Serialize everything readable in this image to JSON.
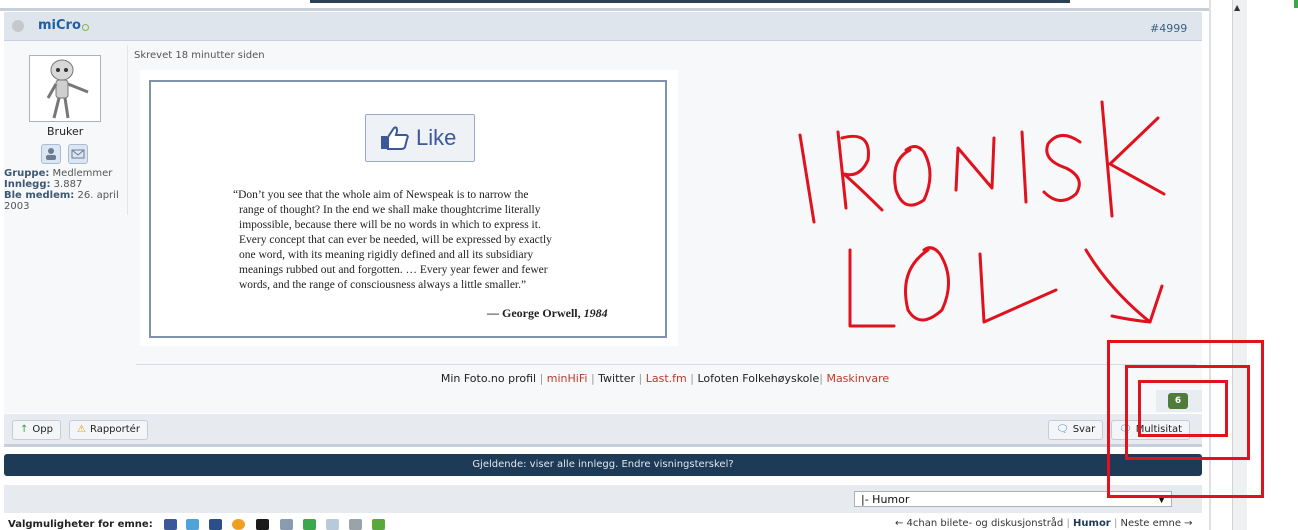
{
  "post": {
    "author": "miCro",
    "post_number": "#4999",
    "timestamp": "Skrevet 18 minutter siden",
    "user": {
      "rank": "Bruker",
      "group_label": "Gruppe:",
      "group_value": "Medlemmer",
      "posts_label": "Innlegg:",
      "posts_value": "3.887",
      "joined_label": "Ble medlem:",
      "joined_value": "26. april 2003"
    },
    "image": {
      "like_label": "Like",
      "quote_lines": [
        "“Don’t you see that the whole aim of Newspeak is to narrow the",
        "range of thought? In the end we shall make thoughtcrime literally",
        "impossible, because there will be no words in which to express it.",
        "Every concept that can ever be needed, will be expressed by exactly",
        "one word, with its meaning rigidly defined and all its subsidiary",
        "meanings rubbed out and forgotten. … Every year fewer and fewer",
        "words, and the range of consciousness always a little smaller.”"
      ],
      "attribution": "— George Orwell,",
      "attribution_title": "1984"
    },
    "drawing_text": [
      "IRONISK",
      "LOL"
    ],
    "signature": {
      "links": [
        {
          "text": "Min Foto.no profil",
          "color": "#222222"
        },
        {
          "text": "minHiFi",
          "color": "#c0392b"
        },
        {
          "text": "Twitter",
          "color": "#222222"
        },
        {
          "text": "Last.fm",
          "color": "#c0392b"
        },
        {
          "text": "Lofoten Folkehøyskole",
          "color": "#222222"
        },
        {
          "text": "Maskinvare",
          "color": "#c0392b"
        }
      ]
    },
    "reputation": "6",
    "buttons": {
      "up": "Opp",
      "report": "Rapportér",
      "reply": "Svar",
      "multiquote": "Multisitat"
    }
  },
  "filter_bar": "Gjeldende: viser alle innlegg. Endre visningsterskel?",
  "forum_select": {
    "value": "|- Humor"
  },
  "topic_options_label": "Valgmuligheter for emne:",
  "share_icons": [
    "facebook-icon",
    "youtube-icon",
    "myspace-icon",
    "google-icon",
    "delicious-icon",
    "digg-icon",
    "technorati-icon",
    "email-icon",
    "print-icon",
    "download-icon"
  ],
  "topic_nav": {
    "prev": "← 4chan bilete- og diskusjonstråd",
    "current": "Humor",
    "next": "Neste emne →"
  },
  "colors": {
    "accent": "#1d5ea8",
    "bar": "#1d3a57",
    "annotation_red": "#e0121e",
    "rep_green": "#4f7c3b"
  }
}
